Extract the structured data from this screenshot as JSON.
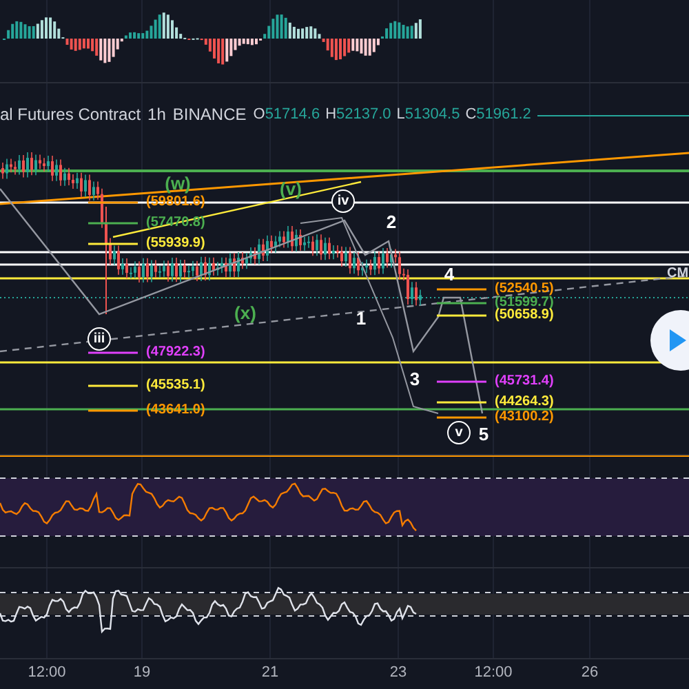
{
  "header": {
    "symbol": "al Futures Contract",
    "interval": "1h",
    "exchange": "BINANCE",
    "ohlc": [
      {
        "label": "O",
        "value": "51714.6"
      },
      {
        "label": "H",
        "value": "52137.0"
      },
      {
        "label": "L",
        "value": "51304.5"
      },
      {
        "label": "C",
        "value": "51961.2"
      }
    ]
  },
  "price_levels": [
    {
      "text": "(59801.6)",
      "color": "#ff9800"
    },
    {
      "text": "(57470.8)",
      "color": "#4caf50"
    },
    {
      "text": "(55939.9)",
      "color": "#ffeb3b"
    },
    {
      "text": "(47922.3)",
      "color": "#e040fb"
    },
    {
      "text": "(45535.1)",
      "color": "#ffeb3b"
    },
    {
      "text": "(43641.0)",
      "color": "#ff9800"
    },
    {
      "text": "(52540.5)",
      "color": "#ff9800"
    },
    {
      "text": "(51599.7)",
      "color": "#4caf50"
    },
    {
      "text": "(50658.9)",
      "color": "#ffeb3b"
    },
    {
      "text": "(45731.4)",
      "color": "#e040fb"
    },
    {
      "text": "(44264.3)",
      "color": "#ffeb3b"
    },
    {
      "text": "(43100.2)",
      "color": "#ff9800"
    }
  ],
  "wave_labels": [
    {
      "text": "(w)",
      "kind": "plain",
      "color": "#4caf50"
    },
    {
      "text": "(v)",
      "kind": "plain",
      "color": "#4caf50"
    },
    {
      "text": "iv",
      "kind": "circled",
      "color": "#ffffff"
    },
    {
      "text": "2",
      "kind": "plain",
      "color": "#ffffff"
    },
    {
      "text": "4",
      "kind": "plain",
      "color": "#ffffff"
    },
    {
      "text": "(x)",
      "kind": "plain",
      "color": "#4caf50"
    },
    {
      "text": "1",
      "kind": "plain",
      "color": "#ffffff"
    },
    {
      "text": "iii",
      "kind": "circled",
      "color": "#ffffff"
    },
    {
      "text": "3",
      "kind": "plain",
      "color": "#ffffff"
    },
    {
      "text": "v",
      "kind": "circled",
      "color": "#ffffff"
    },
    {
      "text": "5",
      "kind": "plain",
      "color": "#ffffff"
    }
  ],
  "line_label": "CM",
  "x_axis": [
    "12:00",
    "19",
    "21",
    "23",
    "12:00",
    "26"
  ]
}
